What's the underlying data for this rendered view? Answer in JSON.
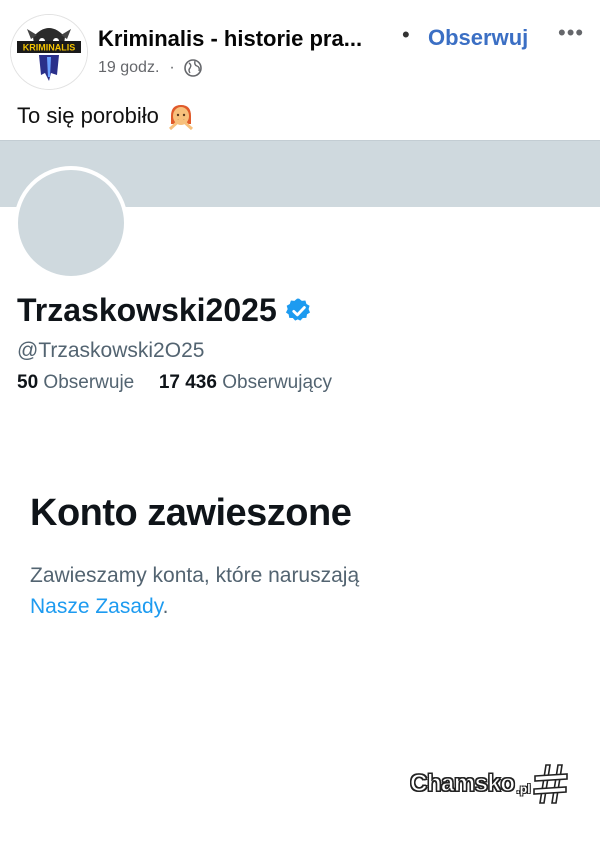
{
  "post": {
    "page_name": "Kriminalis - historie pra...",
    "follow_label": "Obserwuj",
    "separator": "•",
    "more_label": "•••",
    "time_ago": "19 godz.",
    "meta_separator": "·",
    "privacy_icon": "globe-icon",
    "avatar_logo_text": "KRIMINALIS",
    "text": "To się porobiło",
    "emoji": "person-gesturing-no-emoji"
  },
  "screenshot": {
    "display_name": "Trzaskowski2025",
    "verified_icon": "verified-badge-icon",
    "handle": "@Trzaskowski2O25",
    "following_count": "50",
    "following_label": "Obserwuje",
    "followers_count": "17 436",
    "followers_label": "Obserwujący",
    "suspended_title": "Konto zawieszone",
    "suspended_text": "Zawieszamy konta, które naruszają",
    "rules_link": "Nasze Zasady",
    "period": "."
  },
  "watermark": {
    "brand": "Chamsko",
    "tld": ".pl"
  },
  "colors": {
    "fb_link_blue": "#3b6fc4",
    "x_link_blue": "#1d9bf0",
    "banner_gray": "#cfd9de",
    "muted_text": "#536471"
  }
}
